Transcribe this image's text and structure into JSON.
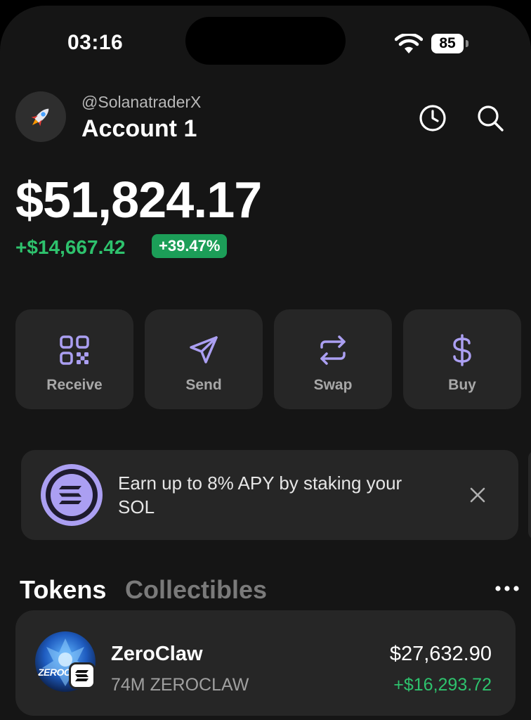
{
  "status_bar": {
    "time": "03:16",
    "battery": "85",
    "icons": [
      "wifi-icon",
      "battery-icon"
    ]
  },
  "header": {
    "handle": "@SolanatraderX",
    "account_name": "Account 1",
    "avatar_icon": "rocket-icon",
    "icons": [
      "history-clock-icon",
      "search-icon"
    ]
  },
  "balance": {
    "total": "$51,824.17",
    "change": "+$14,667.42",
    "change_percent": "+39.47%"
  },
  "actions": [
    {
      "label": "Receive",
      "icon": "qr-code-icon"
    },
    {
      "label": "Send",
      "icon": "send-arrow-icon"
    },
    {
      "label": "Swap",
      "icon": "swap-arrows-icon"
    },
    {
      "label": "Buy",
      "icon": "dollar-icon"
    }
  ],
  "promo": {
    "text": "Earn up to 8% APY by staking your SOL",
    "icon": "solana-logo-icon",
    "close_icon": "close-icon"
  },
  "tabs": {
    "active": "Tokens",
    "inactive": "Collectibles",
    "more_icon": "more-dots-icon"
  },
  "tokens": [
    {
      "name": "ZeroClaw",
      "amount": "74M ZEROCLAW",
      "value": "$27,632.90",
      "change": "+$16,293.72",
      "image_text": "ZEROC",
      "chain_icon": "solana-badge-icon"
    }
  ],
  "colors": {
    "background": "#151515",
    "card": "#262626",
    "accent_purple": "#ab9ff2",
    "positive_green": "#2ec26d",
    "badge_green": "#1c9e58"
  }
}
